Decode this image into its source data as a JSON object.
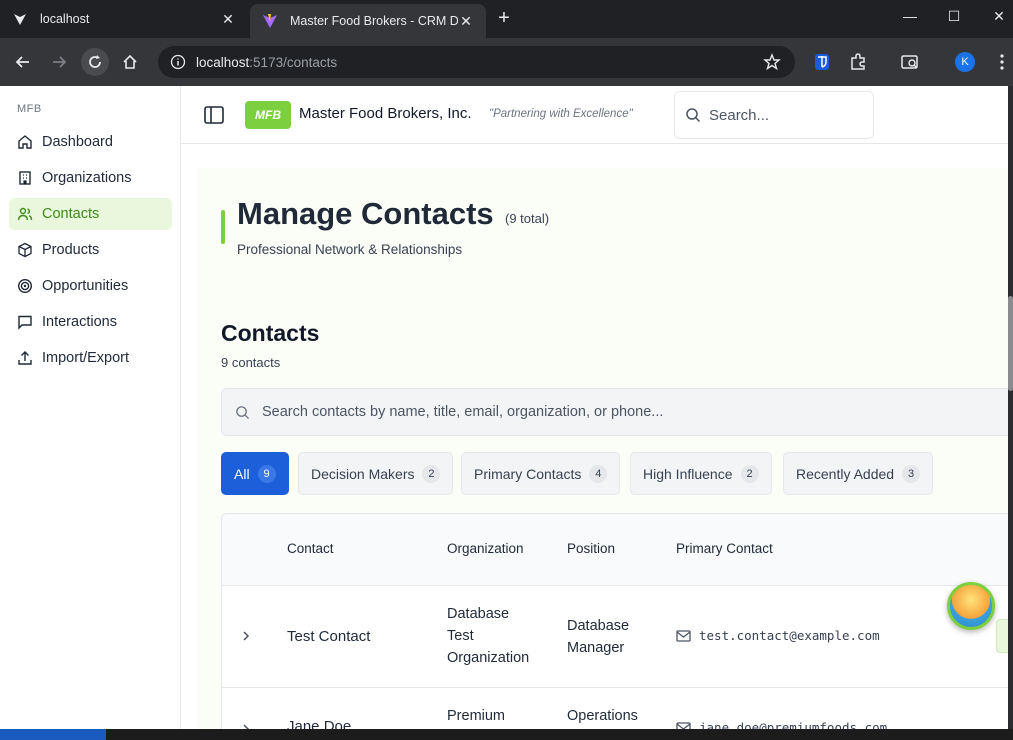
{
  "browser": {
    "tabs": [
      {
        "title": "localhost",
        "active": false
      },
      {
        "title": "Master Food Brokers - CRM Dashboard",
        "active": true
      }
    ],
    "url_host": "localhost",
    "url_path": ":5173/contacts",
    "profile_initial": "K"
  },
  "sidebar": {
    "group_label": "MFB",
    "items": [
      {
        "label": "Dashboard",
        "icon": "home-icon"
      },
      {
        "label": "Organizations",
        "icon": "building-icon"
      },
      {
        "label": "Contacts",
        "icon": "users-icon",
        "active": true
      },
      {
        "label": "Products",
        "icon": "package-icon"
      },
      {
        "label": "Opportunities",
        "icon": "target-icon"
      },
      {
        "label": "Interactions",
        "icon": "message-square-icon"
      },
      {
        "label": "Import/Export",
        "icon": "upload-icon"
      }
    ]
  },
  "header": {
    "logo": "MFB",
    "company": "Master Food Brokers, Inc.",
    "tagline": "\"Partnering with Excellence\"",
    "search_placeholder": "Search..."
  },
  "page": {
    "title": "Manage Contacts",
    "total": "(9 total)",
    "subtitle": "Professional Network & Relationships"
  },
  "contacts_section": {
    "title": "Contacts",
    "count_text": "9 contacts",
    "search_placeholder": "Search contacts by name, title, email, organization, or phone...",
    "filters": [
      {
        "label": "All",
        "count": "9",
        "active": true
      },
      {
        "label": "Decision Makers",
        "count": "2"
      },
      {
        "label": "Primary Contacts",
        "count": "4"
      },
      {
        "label": "High Influence",
        "count": "2"
      },
      {
        "label": "Recently Added",
        "count": "3"
      }
    ],
    "columns": [
      "Contact",
      "Organization",
      "Position",
      "Primary Contact"
    ],
    "rows": [
      {
        "name": "Test Contact",
        "organization": [
          "Database",
          "Test",
          "Organization"
        ],
        "position": [
          "Database",
          "Manager"
        ],
        "email": "test.contact@example.com"
      },
      {
        "name": "Jane Doe",
        "organization": [
          "Premium"
        ],
        "position": [
          "Operations"
        ],
        "email": "jane.doe@premiumfoods.com"
      }
    ]
  },
  "colors": {
    "brand_green": "#7ccf3d",
    "active_blue": "#1d5fd8"
  }
}
